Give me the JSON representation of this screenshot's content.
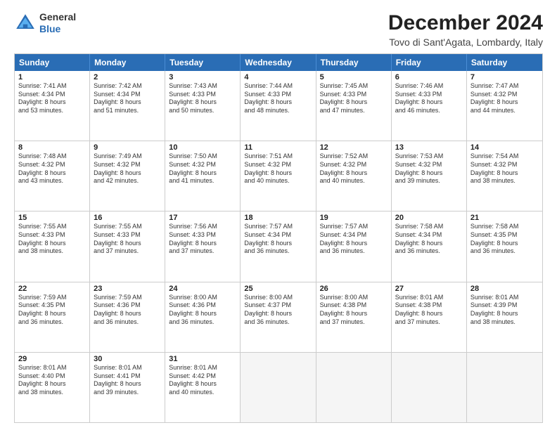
{
  "logo": {
    "general": "General",
    "blue": "Blue"
  },
  "title": "December 2024",
  "location": "Tovo di Sant'Agata, Lombardy, Italy",
  "days": [
    "Sunday",
    "Monday",
    "Tuesday",
    "Wednesday",
    "Thursday",
    "Friday",
    "Saturday"
  ],
  "rows": [
    [
      {
        "day": "1",
        "lines": [
          "Sunrise: 7:41 AM",
          "Sunset: 4:34 PM",
          "Daylight: 8 hours",
          "and 53 minutes."
        ]
      },
      {
        "day": "2",
        "lines": [
          "Sunrise: 7:42 AM",
          "Sunset: 4:34 PM",
          "Daylight: 8 hours",
          "and 51 minutes."
        ]
      },
      {
        "day": "3",
        "lines": [
          "Sunrise: 7:43 AM",
          "Sunset: 4:33 PM",
          "Daylight: 8 hours",
          "and 50 minutes."
        ]
      },
      {
        "day": "4",
        "lines": [
          "Sunrise: 7:44 AM",
          "Sunset: 4:33 PM",
          "Daylight: 8 hours",
          "and 48 minutes."
        ]
      },
      {
        "day": "5",
        "lines": [
          "Sunrise: 7:45 AM",
          "Sunset: 4:33 PM",
          "Daylight: 8 hours",
          "and 47 minutes."
        ]
      },
      {
        "day": "6",
        "lines": [
          "Sunrise: 7:46 AM",
          "Sunset: 4:33 PM",
          "Daylight: 8 hours",
          "and 46 minutes."
        ]
      },
      {
        "day": "7",
        "lines": [
          "Sunrise: 7:47 AM",
          "Sunset: 4:32 PM",
          "Daylight: 8 hours",
          "and 44 minutes."
        ]
      }
    ],
    [
      {
        "day": "8",
        "lines": [
          "Sunrise: 7:48 AM",
          "Sunset: 4:32 PM",
          "Daylight: 8 hours",
          "and 43 minutes."
        ]
      },
      {
        "day": "9",
        "lines": [
          "Sunrise: 7:49 AM",
          "Sunset: 4:32 PM",
          "Daylight: 8 hours",
          "and 42 minutes."
        ]
      },
      {
        "day": "10",
        "lines": [
          "Sunrise: 7:50 AM",
          "Sunset: 4:32 PM",
          "Daylight: 8 hours",
          "and 41 minutes."
        ]
      },
      {
        "day": "11",
        "lines": [
          "Sunrise: 7:51 AM",
          "Sunset: 4:32 PM",
          "Daylight: 8 hours",
          "and 40 minutes."
        ]
      },
      {
        "day": "12",
        "lines": [
          "Sunrise: 7:52 AM",
          "Sunset: 4:32 PM",
          "Daylight: 8 hours",
          "and 40 minutes."
        ]
      },
      {
        "day": "13",
        "lines": [
          "Sunrise: 7:53 AM",
          "Sunset: 4:32 PM",
          "Daylight: 8 hours",
          "and 39 minutes."
        ]
      },
      {
        "day": "14",
        "lines": [
          "Sunrise: 7:54 AM",
          "Sunset: 4:32 PM",
          "Daylight: 8 hours",
          "and 38 minutes."
        ]
      }
    ],
    [
      {
        "day": "15",
        "lines": [
          "Sunrise: 7:55 AM",
          "Sunset: 4:33 PM",
          "Daylight: 8 hours",
          "and 38 minutes."
        ]
      },
      {
        "day": "16",
        "lines": [
          "Sunrise: 7:55 AM",
          "Sunset: 4:33 PM",
          "Daylight: 8 hours",
          "and 37 minutes."
        ]
      },
      {
        "day": "17",
        "lines": [
          "Sunrise: 7:56 AM",
          "Sunset: 4:33 PM",
          "Daylight: 8 hours",
          "and 37 minutes."
        ]
      },
      {
        "day": "18",
        "lines": [
          "Sunrise: 7:57 AM",
          "Sunset: 4:34 PM",
          "Daylight: 8 hours",
          "and 36 minutes."
        ]
      },
      {
        "day": "19",
        "lines": [
          "Sunrise: 7:57 AM",
          "Sunset: 4:34 PM",
          "Daylight: 8 hours",
          "and 36 minutes."
        ]
      },
      {
        "day": "20",
        "lines": [
          "Sunrise: 7:58 AM",
          "Sunset: 4:34 PM",
          "Daylight: 8 hours",
          "and 36 minutes."
        ]
      },
      {
        "day": "21",
        "lines": [
          "Sunrise: 7:58 AM",
          "Sunset: 4:35 PM",
          "Daylight: 8 hours",
          "and 36 minutes."
        ]
      }
    ],
    [
      {
        "day": "22",
        "lines": [
          "Sunrise: 7:59 AM",
          "Sunset: 4:35 PM",
          "Daylight: 8 hours",
          "and 36 minutes."
        ]
      },
      {
        "day": "23",
        "lines": [
          "Sunrise: 7:59 AM",
          "Sunset: 4:36 PM",
          "Daylight: 8 hours",
          "and 36 minutes."
        ]
      },
      {
        "day": "24",
        "lines": [
          "Sunrise: 8:00 AM",
          "Sunset: 4:36 PM",
          "Daylight: 8 hours",
          "and 36 minutes."
        ]
      },
      {
        "day": "25",
        "lines": [
          "Sunrise: 8:00 AM",
          "Sunset: 4:37 PM",
          "Daylight: 8 hours",
          "and 36 minutes."
        ]
      },
      {
        "day": "26",
        "lines": [
          "Sunrise: 8:00 AM",
          "Sunset: 4:38 PM",
          "Daylight: 8 hours",
          "and 37 minutes."
        ]
      },
      {
        "day": "27",
        "lines": [
          "Sunrise: 8:01 AM",
          "Sunset: 4:38 PM",
          "Daylight: 8 hours",
          "and 37 minutes."
        ]
      },
      {
        "day": "28",
        "lines": [
          "Sunrise: 8:01 AM",
          "Sunset: 4:39 PM",
          "Daylight: 8 hours",
          "and 38 minutes."
        ]
      }
    ],
    [
      {
        "day": "29",
        "lines": [
          "Sunrise: 8:01 AM",
          "Sunset: 4:40 PM",
          "Daylight: 8 hours",
          "and 38 minutes."
        ]
      },
      {
        "day": "30",
        "lines": [
          "Sunrise: 8:01 AM",
          "Sunset: 4:41 PM",
          "Daylight: 8 hours",
          "and 39 minutes."
        ]
      },
      {
        "day": "31",
        "lines": [
          "Sunrise: 8:01 AM",
          "Sunset: 4:42 PM",
          "Daylight: 8 hours",
          "and 40 minutes."
        ]
      },
      null,
      null,
      null,
      null
    ]
  ]
}
